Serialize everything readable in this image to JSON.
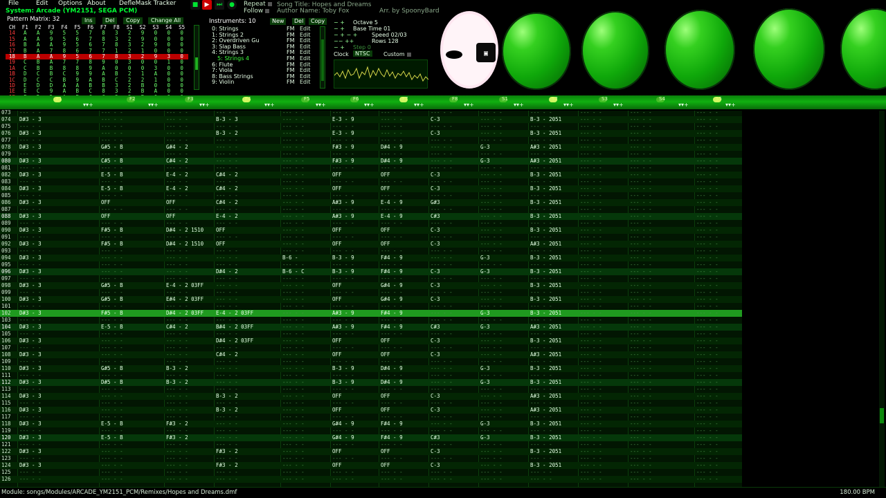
{
  "menu": [
    "File",
    "Edit",
    "Options",
    "About",
    "DefleMask Tracker"
  ],
  "system": "System: Arcade (YM2151, SEGA PCM)",
  "transport": {
    "stop_icon": "stop-icon",
    "play_icon": "play-icon",
    "step_icon": "step-icon",
    "record_icon": "record-icon",
    "repeat_label": "Repeat",
    "follow_label": "Follow"
  },
  "song": {
    "title": "Song Title: Hopes and Dreams",
    "author": "Author Name: Toby Fox",
    "arranger": "Arr. by SpoonyBard"
  },
  "pattern_matrix": {
    "title": "Pattern Matrix: 32",
    "buttons": [
      "Ins",
      "Del",
      "Copy",
      "Change All"
    ],
    "headers": [
      "CH",
      "F1",
      "F2",
      "F3",
      "F4",
      "F5",
      "F6",
      "F7",
      "F8",
      "S1",
      "S2",
      "S3",
      "S4",
      "S5"
    ],
    "rows": [
      [
        "14",
        "A",
        "A",
        "9",
        "5",
        "5",
        "7",
        "8",
        "3",
        "2",
        "9",
        "0",
        "0",
        "0"
      ],
      [
        "15",
        "A",
        "A",
        "9",
        "5",
        "6",
        "7",
        "8",
        "3",
        "2",
        "9",
        "0",
        "0",
        "0"
      ],
      [
        "16",
        "B",
        "A",
        "A",
        "9",
        "5",
        "6",
        "7",
        "8",
        "3",
        "2",
        "9",
        "0",
        "0"
      ],
      [
        "17",
        "B",
        "A",
        "7",
        "8",
        "6",
        "7",
        "7",
        "1",
        "2",
        "1",
        "0",
        "0",
        "0"
      ],
      [
        "18",
        "B",
        "A",
        "A",
        "9",
        "5",
        "6",
        "7",
        "8",
        "3",
        "2",
        "9",
        "3",
        "0"
      ],
      [
        "19",
        "C",
        "B",
        "A",
        "7",
        "7",
        "8",
        "9",
        "0",
        "3",
        "0",
        "0",
        "1",
        "0"
      ],
      [
        "1A",
        "C",
        "B",
        "B",
        "8",
        "8",
        "9",
        "A",
        "0",
        "0",
        "0",
        "3",
        "0",
        "0"
      ],
      [
        "1B",
        "D",
        "C",
        "B",
        "C",
        "9",
        "9",
        "A",
        "B",
        "2",
        "1",
        "A",
        "0",
        "0"
      ],
      [
        "1C",
        "D",
        "C",
        "C",
        "B",
        "9",
        "A",
        "B",
        "C",
        "2",
        "2",
        "1",
        "0",
        "0"
      ],
      [
        "1D",
        "E",
        "D",
        "D",
        "A",
        "A",
        "B",
        "B",
        "3",
        "2",
        "B",
        "0",
        "0",
        "0"
      ],
      [
        "1E",
        "E",
        "C",
        "9",
        "A",
        "B",
        "C",
        "8",
        "3",
        "2",
        "B",
        "A",
        "0",
        "0"
      ],
      [
        "1F",
        "F",
        "D",
        "D",
        "A",
        "B",
        "C",
        "C",
        "3",
        "2",
        "B",
        "0",
        "0",
        "0"
      ]
    ]
  },
  "instruments": {
    "title": "Instruments: 10",
    "buttons": [
      "New",
      "Del",
      "Copy"
    ],
    "items": [
      {
        "name": "0: Strings",
        "type": "FM",
        "action": "Edit"
      },
      {
        "name": "1: Strings 2",
        "type": "FM",
        "action": "Edit"
      },
      {
        "name": "2: Overdriven Gu",
        "type": "FM",
        "action": "Edit"
      },
      {
        "name": "3: Slap Bass",
        "type": "FM",
        "action": "Edit"
      },
      {
        "name": "4: Strings 3",
        "type": "FM",
        "action": "Edit"
      },
      {
        "name": "5: Strings 4",
        "type": "FM",
        "action": "Edit"
      },
      {
        "name": "6: Flute",
        "type": "FM",
        "action": "Edit"
      },
      {
        "name": "7: Viola",
        "type": "FM",
        "action": "Edit"
      },
      {
        "name": "8: Bass Strings",
        "type": "FM",
        "action": "Edit"
      },
      {
        "name": "9: Violin",
        "type": "FM",
        "action": "Edit"
      }
    ],
    "selected_index": 5
  },
  "params": {
    "octave": "Octave 5",
    "base_time": "Base Time 01",
    "speed": "Speed 02/03",
    "rows": "Rows 128",
    "step": "Step 0",
    "clock_label": "Clock",
    "clock_value": "NTSC",
    "custom_label": "Custom"
  },
  "channel_headers": [
    {
      "label": "F1"
    },
    {
      "label": "F2"
    },
    {
      "label": "F3"
    },
    {
      "label": "F4"
    },
    {
      "label": "F5"
    },
    {
      "label": "F6"
    },
    {
      "label": "F7"
    },
    {
      "label": "F8"
    },
    {
      "label": "S1"
    },
    {
      "label": "S2"
    },
    {
      "label": "S3"
    },
    {
      "label": "S4"
    },
    {
      "label": "S5"
    }
  ],
  "pattern": {
    "rows": [
      {
        "n": "073",
        "c": [
          "",
          "",
          "",
          "",
          "",
          "",
          "",
          "",
          "",
          "",
          "",
          "",
          ""
        ]
      },
      {
        "n": "074",
        "c": [
          "D#3 - 3",
          "",
          "",
          "B-3 - 3",
          "",
          "E-3 - 9",
          "",
          "C-3",
          "",
          "B-3 - 2051",
          "",
          "",
          ""
        ]
      },
      {
        "n": "075",
        "c": [
          "",
          "",
          "",
          "",
          "",
          "",
          "",
          "",
          "",
          "",
          "",
          "",
          ""
        ]
      },
      {
        "n": "076",
        "c": [
          "D#3 - 3",
          "",
          "",
          "B-3 - 2",
          "",
          "E-3 - 9",
          "",
          "C-3",
          "",
          "B-3 - 2051",
          "",
          "",
          ""
        ]
      },
      {
        "n": "077",
        "c": [
          "",
          "",
          "",
          "",
          "",
          "",
          "",
          "",
          "",
          "",
          "",
          "",
          ""
        ]
      },
      {
        "n": "078",
        "c": [
          "D#3 - 3",
          "G#5 - B",
          "G#4 - 2",
          "",
          "",
          "F#3 - 9",
          "D#4 - 9",
          "",
          "G-3",
          "A#3 - 2051",
          "",
          "",
          ""
        ]
      },
      {
        "n": "079",
        "c": [
          "",
          "",
          "",
          "",
          "",
          "",
          "",
          "",
          "",
          "",
          "",
          "",
          ""
        ]
      },
      {
        "n": "080",
        "c": [
          "D#3 - 3",
          "C#5 - B",
          "C#4 - 2",
          "",
          "",
          "F#3 - 9",
          "D#4 - 9",
          "",
          "G-3",
          "A#3 - 2051",
          "",
          "",
          ""
        ]
      },
      {
        "n": "081",
        "c": [
          "",
          "",
          "",
          "",
          "",
          "",
          "",
          "",
          "",
          "",
          "",
          "",
          ""
        ]
      },
      {
        "n": "082",
        "c": [
          "D#3 - 3",
          "E-5 - B",
          "E-4 - 2",
          "C#4 - 2",
          "",
          "OFF",
          "OFF",
          "C-3",
          "",
          "B-3 - 2051",
          "",
          "",
          ""
        ]
      },
      {
        "n": "083",
        "c": [
          "",
          "",
          "",
          "",
          "",
          "",
          "",
          "",
          "",
          "",
          "",
          "",
          ""
        ]
      },
      {
        "n": "084",
        "c": [
          "D#3 - 3",
          "E-5 - B",
          "E-4 - 2",
          "C#4 - 2",
          "",
          "OFF",
          "OFF",
          "C-3",
          "",
          "B-3 - 2051",
          "",
          "",
          ""
        ]
      },
      {
        "n": "085",
        "c": [
          "",
          "",
          "",
          "",
          "",
          "",
          "",
          "",
          "",
          "",
          "",
          "",
          ""
        ]
      },
      {
        "n": "086",
        "c": [
          "D#3 - 3",
          "OFF",
          "OFF",
          "C#4 - 2",
          "",
          "A#3 - 9",
          "E-4 - 9",
          "G#3",
          "",
          "B-3 - 2051",
          "",
          "",
          ""
        ]
      },
      {
        "n": "087",
        "c": [
          "",
          "",
          "",
          "",
          "",
          "",
          "",
          "",
          "",
          "",
          "",
          "",
          ""
        ]
      },
      {
        "n": "088",
        "c": [
          "D#3 - 3",
          "OFF",
          "OFF",
          "E-4 - 2",
          "",
          "A#3 - 9",
          "E-4 - 9",
          "C#3",
          "",
          "B-3 - 2051",
          "",
          "",
          ""
        ]
      },
      {
        "n": "089",
        "c": [
          "",
          "",
          "",
          "",
          "",
          "",
          "",
          "",
          "",
          "",
          "",
          "",
          ""
        ]
      },
      {
        "n": "090",
        "c": [
          "D#3 - 3",
          "F#5 - B",
          "D#4 - 2 1510",
          "OFF",
          "",
          "OFF",
          "OFF",
          "C-3",
          "",
          "B-3 - 2051",
          "",
          "",
          ""
        ]
      },
      {
        "n": "091",
        "c": [
          "",
          "",
          "",
          "",
          "",
          "",
          "",
          "",
          "",
          "",
          "",
          "",
          ""
        ]
      },
      {
        "n": "092",
        "c": [
          "D#3 - 3",
          "F#5 - B",
          "D#4 - 2 1510",
          "OFF",
          "",
          "OFF",
          "OFF",
          "C-3",
          "",
          "A#3 - 2051",
          "",
          "",
          ""
        ]
      },
      {
        "n": "093",
        "c": [
          "",
          "",
          "",
          "",
          "",
          "",
          "",
          "",
          "",
          "",
          "",
          "",
          ""
        ]
      },
      {
        "n": "094",
        "c": [
          "D#3 - 3",
          "",
          "",
          "",
          "B-6 -",
          "B-3 - 9",
          "F#4 - 9",
          "",
          "G-3",
          "B-3 - 2051",
          "",
          "",
          ""
        ]
      },
      {
        "n": "095",
        "c": [
          "",
          "",
          "",
          "",
          "",
          "",
          "",
          "",
          "",
          "",
          "",
          "",
          ""
        ]
      },
      {
        "n": "096",
        "c": [
          "D#3 - 3",
          "",
          "",
          "D#4 - 2",
          "B-6 - C",
          "B-3 - 9",
          "F#4 - 9",
          "C-3",
          "G-3",
          "B-3 - 2051",
          "",
          "",
          ""
        ]
      },
      {
        "n": "097",
        "c": [
          "",
          "",
          "",
          "",
          "",
          "",
          "",
          "",
          "",
          "",
          "",
          "",
          ""
        ]
      },
      {
        "n": "098",
        "c": [
          "D#3 - 3",
          "G#5 - B",
          "E-4 - 2 03FF",
          "",
          "",
          "OFF",
          "G#4 - 9",
          "C-3",
          "",
          "B-3 - 2051",
          "",
          "",
          ""
        ]
      },
      {
        "n": "099",
        "c": [
          "",
          "",
          "",
          "",
          "",
          "",
          "",
          "",
          "",
          "",
          "",
          "",
          ""
        ]
      },
      {
        "n": "100",
        "c": [
          "D#3 - 3",
          "G#5 - B",
          "E#4 - 2 03FF",
          "",
          "",
          "OFF",
          "G#4 - 9",
          "C-3",
          "",
          "B-3 - 2051",
          "",
          "",
          ""
        ]
      },
      {
        "n": "101",
        "c": [
          "",
          "",
          "",
          "",
          "",
          "",
          "",
          "",
          "",
          "",
          "",
          "",
          ""
        ]
      },
      {
        "n": "102",
        "c": [
          "D#3 - 3",
          "F#5 - B",
          "D#4 - 2 03FF",
          "E-4 - 2 03FF",
          "",
          "A#3 - 9",
          "F#4 - 9",
          "",
          "G-3",
          "B-3 - 2051",
          "",
          "",
          ""
        ]
      },
      {
        "n": "103",
        "c": [
          "",
          "",
          "",
          "",
          "",
          "",
          "",
          "",
          "",
          "",
          "",
          "",
          ""
        ]
      },
      {
        "n": "104",
        "c": [
          "D#3 - 3",
          "E-5 - B",
          "C#4 - 2",
          "B#4 - 2 03FF",
          "",
          "A#3 - 9",
          "F#4 - 9",
          "C#3",
          "G-3",
          "A#3 - 2051",
          "",
          "",
          ""
        ]
      },
      {
        "n": "105",
        "c": [
          "",
          "",
          "",
          "",
          "",
          "",
          "",
          "",
          "",
          "",
          "",
          "",
          ""
        ]
      },
      {
        "n": "106",
        "c": [
          "D#3 - 3",
          "",
          "",
          "D#4 - 2 03FF",
          "",
          "OFF",
          "OFF",
          "C-3",
          "",
          "B-3 - 2051",
          "",
          "",
          ""
        ]
      },
      {
        "n": "107",
        "c": [
          "",
          "",
          "",
          "",
          "",
          "",
          "",
          "",
          "",
          "",
          "",
          "",
          ""
        ]
      },
      {
        "n": "108",
        "c": [
          "D#3 - 3",
          "",
          "",
          "C#4 - 2",
          "",
          "OFF",
          "OFF",
          "C-3",
          "",
          "A#3 - 2051",
          "",
          "",
          ""
        ]
      },
      {
        "n": "109",
        "c": [
          "",
          "",
          "",
          "",
          "",
          "",
          "",
          "",
          "",
          "",
          "",
          "",
          ""
        ]
      },
      {
        "n": "110",
        "c": [
          "D#3 - 3",
          "G#5 - B",
          "B-3 - 2",
          "",
          "",
          "B-3 - 9",
          "D#4 - 9",
          "",
          "G-3",
          "B-3 - 2051",
          "",
          "",
          ""
        ]
      },
      {
        "n": "111",
        "c": [
          "",
          "",
          "",
          "",
          "",
          "",
          "",
          "",
          "",
          "",
          "",
          "",
          ""
        ]
      },
      {
        "n": "112",
        "c": [
          "D#3 - 3",
          "D#5 - B",
          "B-3 - 2",
          "",
          "",
          "B-3 - 9",
          "D#4 - 9",
          "",
          "G-3",
          "B-3 - 2051",
          "",
          "",
          ""
        ]
      },
      {
        "n": "113",
        "c": [
          "",
          "",
          "",
          "",
          "",
          "",
          "",
          "",
          "",
          "",
          "",
          "",
          ""
        ]
      },
      {
        "n": "114",
        "c": [
          "D#3 - 3",
          "",
          "",
          "B-3 - 2",
          "",
          "OFF",
          "OFF",
          "C-3",
          "",
          "A#3 - 2051",
          "",
          "",
          ""
        ]
      },
      {
        "n": "115",
        "c": [
          "",
          "",
          "",
          "",
          "",
          "",
          "",
          "",
          "",
          "",
          "",
          "",
          ""
        ]
      },
      {
        "n": "116",
        "c": [
          "D#3 - 3",
          "",
          "",
          "B-3 - 2",
          "",
          "OFF",
          "OFF",
          "C-3",
          "",
          "A#3 - 2051",
          "",
          "",
          ""
        ]
      },
      {
        "n": "117",
        "c": [
          "",
          "",
          "",
          "",
          "",
          "",
          "",
          "",
          "",
          "",
          "",
          "",
          ""
        ]
      },
      {
        "n": "118",
        "c": [
          "D#3 - 3",
          "E-5 - B",
          "F#3 - 2",
          "",
          "",
          "G#4 - 9",
          "F#4 - 9",
          "",
          "G-3",
          "B-3 - 2051",
          "",
          "",
          ""
        ]
      },
      {
        "n": "119",
        "c": [
          "",
          "",
          "",
          "",
          "",
          "",
          "",
          "",
          "",
          "",
          "",
          "",
          ""
        ]
      },
      {
        "n": "120",
        "c": [
          "D#3 - 3",
          "E-5 - B",
          "F#3 - 2",
          "",
          "",
          "G#4 - 9",
          "F#4 - 9",
          "C#3",
          "G-3",
          "B-3 - 2051",
          "",
          "",
          ""
        ]
      },
      {
        "n": "121",
        "c": [
          "",
          "",
          "",
          "",
          "",
          "",
          "",
          "",
          "",
          "",
          "",
          "",
          ""
        ]
      },
      {
        "n": "122",
        "c": [
          "D#3 - 3",
          "",
          "",
          "F#3 - 2",
          "",
          "OFF",
          "OFF",
          "C-3",
          "",
          "B-3 - 2051",
          "",
          "",
          ""
        ]
      },
      {
        "n": "123",
        "c": [
          "",
          "",
          "",
          "",
          "",
          "",
          "",
          "",
          "",
          "",
          "",
          "",
          ""
        ]
      },
      {
        "n": "124",
        "c": [
          "D#3 - 3",
          "",
          "",
          "F#3 - 2",
          "",
          "OFF",
          "OFF",
          "C-3",
          "",
          "B-3 - 2051",
          "",
          "",
          ""
        ]
      },
      {
        "n": "125",
        "c": [
          "",
          "",
          "",
          "",
          "",
          "",
          "",
          "",
          "",
          "",
          "",
          "",
          ""
        ]
      },
      {
        "n": "126",
        "c": [
          "",
          "",
          "",
          "",
          "",
          "",
          "",
          "",
          "",
          "",
          "",
          "",
          ""
        ]
      }
    ],
    "current_row": "102"
  },
  "status": {
    "path": "Module: songs/Modules/ARCADE_YM2151_PCM/Remixes/Hopes and Dreams.dmf",
    "bpm": "180.00 BPM"
  },
  "colors": {
    "accent": "#00ff33",
    "background": "#000000",
    "grid_bg": "#021602",
    "current_row": "#1f9a1f"
  }
}
